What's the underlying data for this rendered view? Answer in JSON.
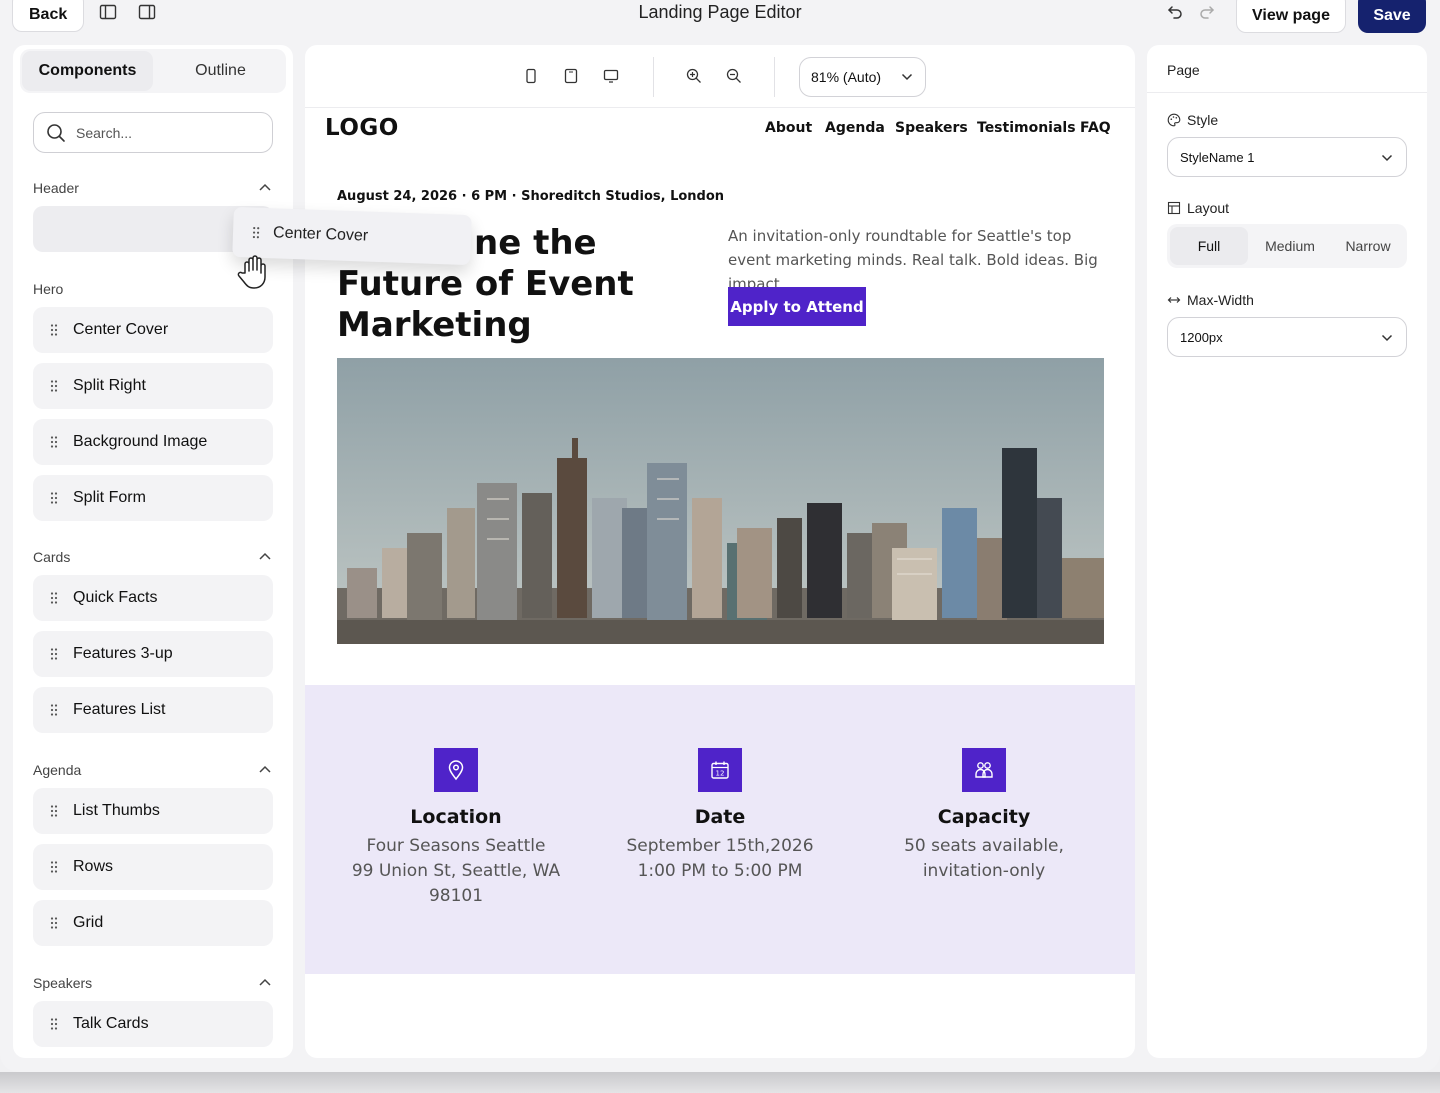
{
  "topbar": {
    "back_label": "Back",
    "title": "Landing Page Editor",
    "view_label": "View page",
    "save_label": "Save",
    "save_color": "#15226e"
  },
  "sidebar": {
    "tabs": [
      {
        "label": "Components",
        "active": true
      },
      {
        "label": "Outline",
        "active": false
      }
    ],
    "search_placeholder": "Search...",
    "groups": [
      {
        "title": "Header",
        "items": []
      },
      {
        "title": "Hero",
        "items": [
          "Center Cover",
          "Split Right",
          "Background Image",
          "Split Form"
        ]
      },
      {
        "title": "Cards",
        "items": [
          "Quick Facts",
          "Features 3-up",
          "Features List"
        ]
      },
      {
        "title": "Agenda",
        "items": [
          "List Thumbs",
          "Rows",
          "Grid"
        ]
      },
      {
        "title": "Speakers",
        "items": [
          "Talk Cards"
        ]
      }
    ],
    "dragging_item": "Center Cover"
  },
  "canvas": {
    "zoom_label": "81% (Auto)",
    "preview": {
      "logo": "LOGO",
      "nav": [
        "About",
        "Agenda",
        "Speakers",
        "Testimonials",
        "FAQ"
      ],
      "meta": "August 24, 2026 · 6 PM · Shoreditch Studios, London",
      "headline_visible": "ne the Future of Event Marketing",
      "description": "An invitation-only roundtable for Seattle's top event marketing minds. Real talk. Bold ideas. Big impact.",
      "cta_label": "Apply to Attend",
      "accent": "#4f23c9",
      "facts": [
        {
          "icon": "location-icon",
          "title": "Location",
          "lines": [
            "Four Seasons Seattle",
            "99 Union St, Seattle, WA",
            "98101"
          ]
        },
        {
          "icon": "calendar-icon",
          "title": "Date",
          "lines": [
            "September 15th,2026",
            "1:00 PM to 5:00 PM"
          ]
        },
        {
          "icon": "people-icon",
          "title": "Capacity",
          "lines": [
            "50 seats available,",
            "invitation-only"
          ]
        }
      ],
      "calendar_day": "12"
    }
  },
  "rpanel": {
    "title": "Page",
    "style_label": "Style",
    "style_value": "StyleName 1",
    "layout_label": "Layout",
    "layout_options": [
      {
        "label": "Full",
        "active": true
      },
      {
        "label": "Medium",
        "active": false
      },
      {
        "label": "Narrow",
        "active": false
      }
    ],
    "maxwidth_label": "Max-Width",
    "maxwidth_value": "1200px"
  }
}
